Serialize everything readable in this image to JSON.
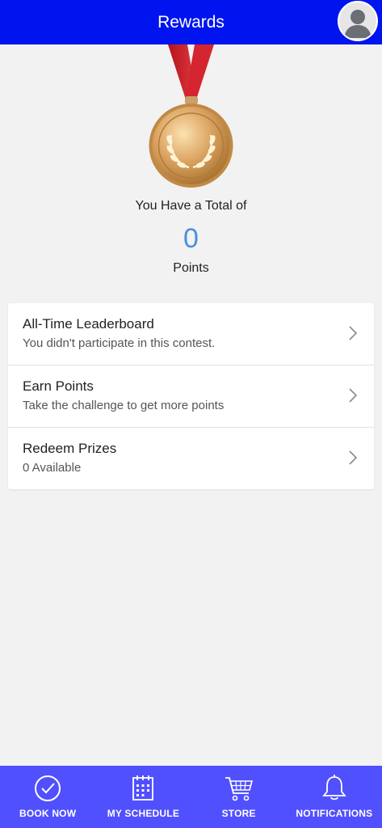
{
  "header": {
    "title": "Rewards"
  },
  "summary": {
    "total_label": "You Have a Total of",
    "points": "0",
    "points_label": "Points"
  },
  "menu": [
    {
      "title": "All-Time Leaderboard",
      "subtitle": "You didn't participate in this contest."
    },
    {
      "title": "Earn Points",
      "subtitle": "Take the challenge to get more points"
    },
    {
      "title": "Redeem Prizes",
      "subtitle": "0 Available"
    }
  ],
  "nav": [
    {
      "label": "BOOK NOW",
      "icon": "check-circle-icon"
    },
    {
      "label": "MY SCHEDULE",
      "icon": "calendar-icon"
    },
    {
      "label": "STORE",
      "icon": "cart-icon"
    },
    {
      "label": "NOTIFICATIONS",
      "icon": "bell-icon"
    }
  ],
  "colors": {
    "header_bg": "#0014f0",
    "nav_bg": "#5050ff",
    "points_accent": "#4a8fdc",
    "medal_ribbon": "#c8202a",
    "medal_gold": "#d9a55a"
  }
}
